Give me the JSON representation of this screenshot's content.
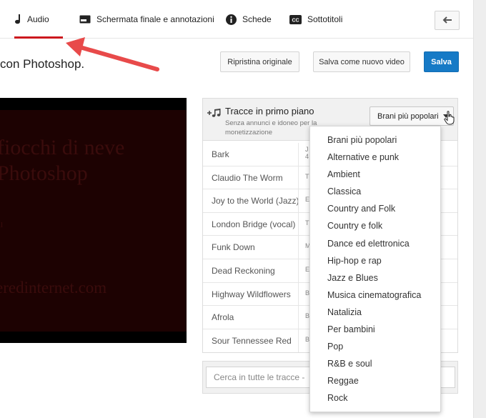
{
  "tabs": [
    {
      "label": "Audio",
      "icon": "music-note-icon",
      "active": true
    },
    {
      "label": "Schermata finale e annotazioni",
      "icon": "end-screen-icon"
    },
    {
      "label": "Schede",
      "icon": "info-icon"
    },
    {
      "label": "Sottotitoli",
      "icon": "cc-icon"
    }
  ],
  "video_title": "con Photoshop.",
  "actions": {
    "restore": "Ripristina originale",
    "save_as_new": "Salva come nuovo video",
    "save": "Salva"
  },
  "video_preview": {
    "line1": "fiocchi di neve",
    "line2": "Photoshop",
    "line3": "ll",
    "line4": "eredinternet.com"
  },
  "panel": {
    "title": "Tracce in primo piano",
    "subtitle": "Senza annunci e idoneo per la monetizzazione",
    "genre_button": "Brani più popolari"
  },
  "tracks": [
    {
      "name": "Bark",
      "col2": "J\n4"
    },
    {
      "name": "Claudio The Worm",
      "col2": "T"
    },
    {
      "name": "Joy to the World (Jazz)",
      "col2": "E"
    },
    {
      "name": "London Bridge (vocal)",
      "col2": "T"
    },
    {
      "name": "Funk Down",
      "col2": "M"
    },
    {
      "name": "Dead Reckoning",
      "col2": "E"
    },
    {
      "name": "Highway Wildflowers",
      "col2": "B"
    },
    {
      "name": "Afrola",
      "col2": "B"
    },
    {
      "name": "Sour Tennessee Red",
      "col2": "B"
    }
  ],
  "search": {
    "placeholder": "Cerca in tutte le tracce -"
  },
  "genres": [
    "Brani più popolari",
    "Alternative e punk",
    "Ambient",
    "Classica",
    "Country and Folk",
    "Country e folk",
    "Dance ed elettronica",
    "Hip-hop e rap",
    "Jazz e Blues",
    "Musica cinematografica",
    "Natalizia",
    "Per bambini",
    "Pop",
    "R&B e soul",
    "Reggae",
    "Rock"
  ],
  "colors": {
    "accent_red": "#cc181e",
    "save_blue": "#167ac6",
    "annotation_arrow": "#e84a4a"
  }
}
